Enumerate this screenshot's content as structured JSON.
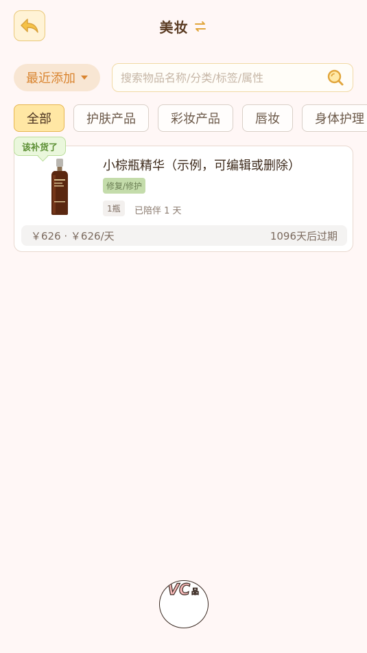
{
  "header": {
    "title": "美妆",
    "back_icon": "back-arrow-icon",
    "swap_icon": "swap-arrows-icon"
  },
  "toolbar": {
    "sort_label": "最近添加",
    "search_placeholder": "搜索物品名称/分类/标签/属性",
    "search_value": ""
  },
  "tabs": [
    {
      "label": "全部",
      "active": true
    },
    {
      "label": "护肤产品",
      "active": false
    },
    {
      "label": "彩妆产品",
      "active": false
    },
    {
      "label": "唇妆",
      "active": false
    },
    {
      "label": "身体护理",
      "active": false
    }
  ],
  "items": [
    {
      "status_tag": "该补货了",
      "name": "小棕瓶精华（示例，可编辑或删除）",
      "tag": "修复/修护",
      "quantity": "1瓶",
      "days_with": "已陪伴 1 天",
      "price_info": "￥626 · ￥626/天",
      "expiry": "1096天后过期"
    }
  ],
  "fab": {
    "label": "VC品"
  },
  "colors": {
    "background": "#fff7f6",
    "accent": "#d9842f",
    "active_tab": "#ffe7a4",
    "restock_green": "#5c8f34"
  }
}
